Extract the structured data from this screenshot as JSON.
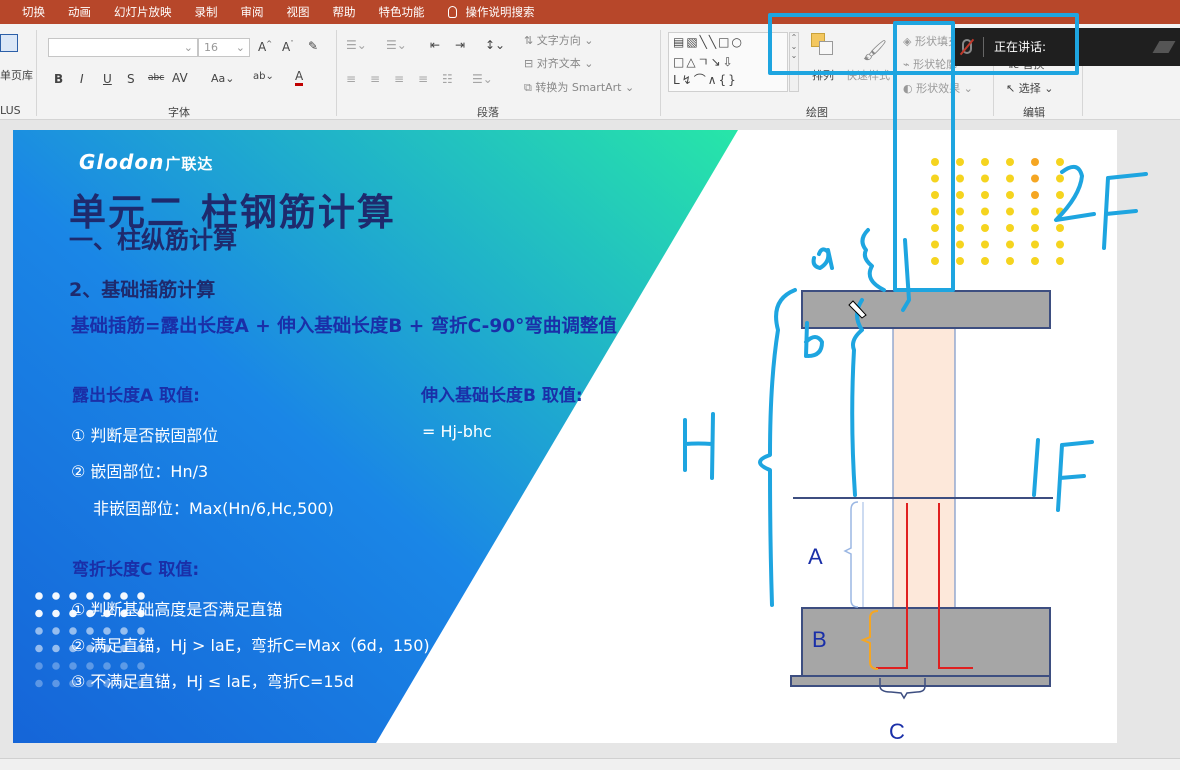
{
  "ribbon": {
    "tabs": [
      "切换",
      "动画",
      "幻灯片放映",
      "录制",
      "审阅",
      "视图",
      "帮助",
      "特色功能"
    ],
    "search_label": "操作说明搜索",
    "left_labels": [
      "单页库",
      "LUS"
    ],
    "font_size": "16",
    "groups": [
      "字体",
      "段落",
      "绘图",
      "编辑"
    ],
    "paragraph": {
      "text_direction": "文字方向",
      "align_text": "对齐文本",
      "convert_smartart": "转换为 SmartArt"
    },
    "drawing": {
      "arrange": "排列",
      "quick_styles": "快速样式",
      "shape_fill": "形状填充",
      "shape_outline": "形状轮廓",
      "shape_effects": "形状效果"
    },
    "editing": {
      "replace": "替换",
      "select": "选择"
    }
  },
  "presenter": {
    "speaking_label": "正在讲话:"
  },
  "slide": {
    "logo_text": "Glodon",
    "logo_cn": "广联达",
    "title": "单元二 柱钢筋计算",
    "subtitle": "一、柱纵筋计算",
    "section": "2、基础插筋计算",
    "formula": "基础插筋=露出长度A + 伸入基础长度B + 弯折C-90°弯曲调整值",
    "a_heading": "露出长度A 取值:",
    "a_items": [
      "① 判断是否嵌固部位",
      "② 嵌固部位：Hn/3",
      "非嵌固部位：Max(Hn/6,Hc,500)"
    ],
    "b_heading": "伸入基础长度B 取值:",
    "b_value": "= Hj-bhc",
    "c_heading": "弯折长度C 取值:",
    "c_items": [
      "① 判断基础高度是否满足直锚",
      "② 满足直锚，Hj > laE，弯折C=Max（6d，150)",
      "③ 不满足直锚，Hj ≤ laE，弯折C=15d"
    ],
    "diagram_labels": {
      "a": "A",
      "b": "B",
      "c": "C"
    },
    "handwriting": {
      "a": "a",
      "b": "b",
      "H": "H",
      "floor2": "2F",
      "floor1": "1F"
    }
  },
  "colors": {
    "ribbon_red": "#b7472a",
    "slide_gradient_start": "#1565d8",
    "slide_gradient_end": "#27e6a8",
    "title_navy": "#1e2a6d",
    "text_blue": "#1a2fa8",
    "annotation_cyan": "#1ea5e0",
    "rebar_red": "#e02020",
    "bracket_orange": "#f5a623",
    "concrete_gray": "#a6a6a6",
    "column_fill": "#fde8da"
  }
}
